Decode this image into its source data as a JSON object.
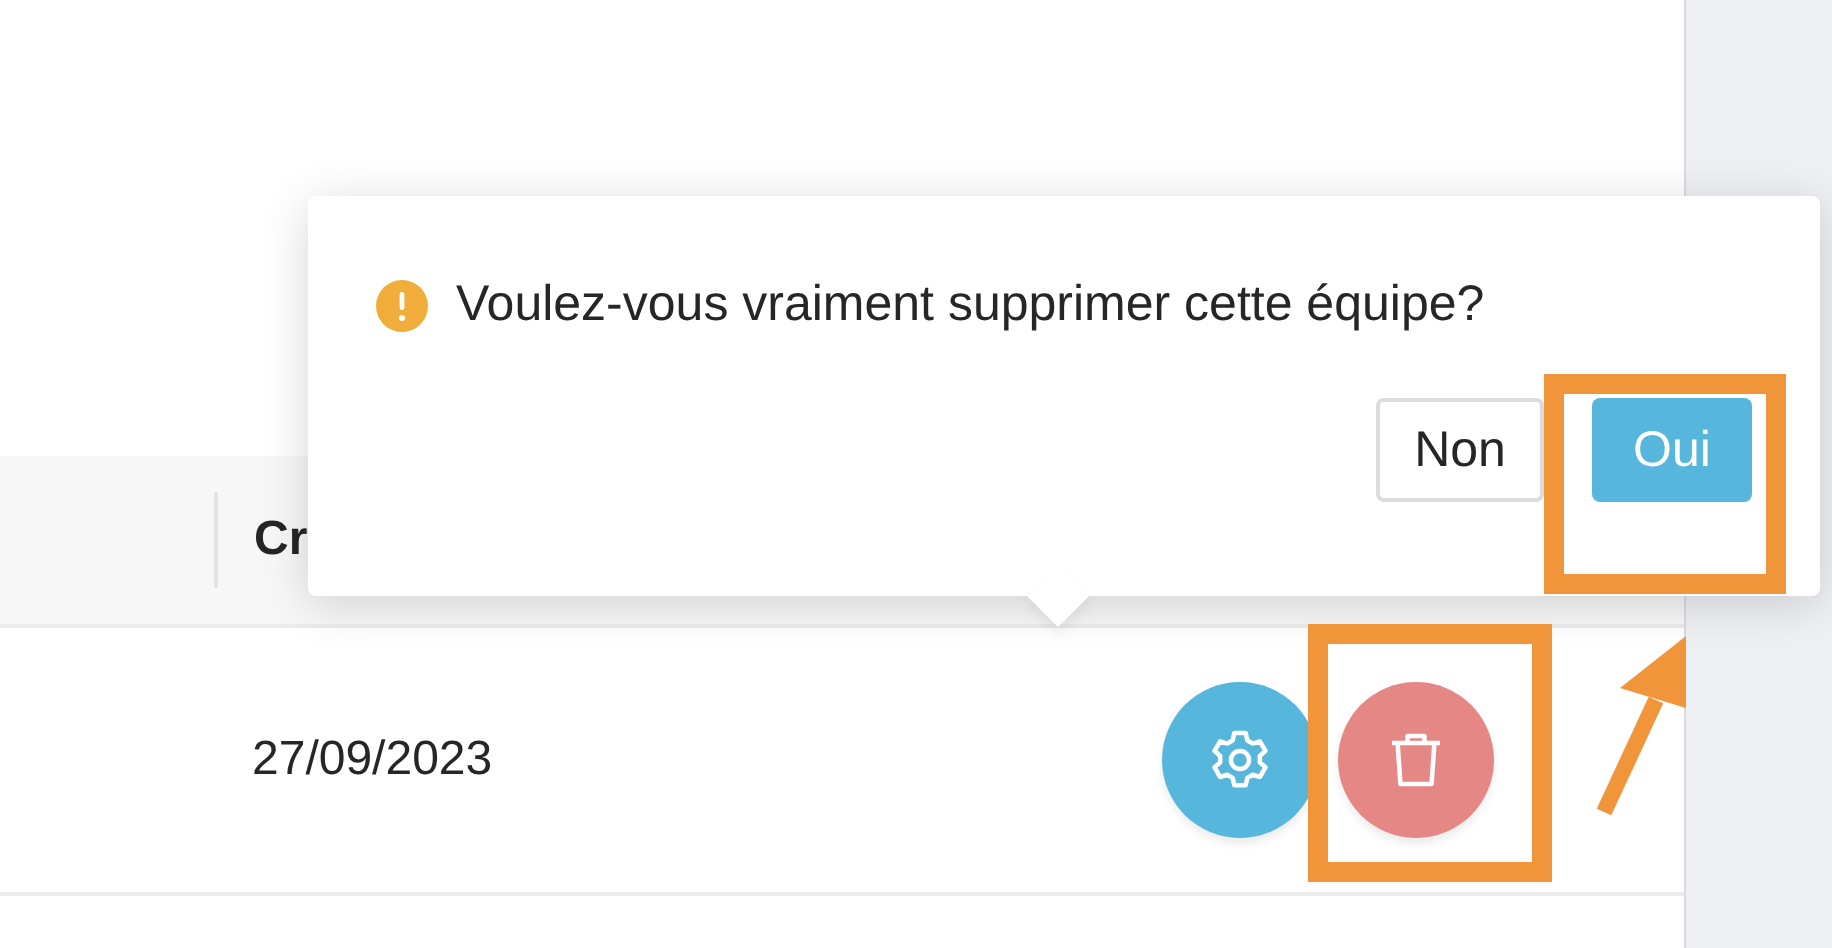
{
  "table": {
    "column_header": "Cr",
    "rows": [
      {
        "date": "27/09/2023",
        "actions": [
          {
            "kind": "settings"
          },
          {
            "kind": "delete"
          }
        ]
      }
    ]
  },
  "popconfirm": {
    "message": "Voulez-vous vraiment supprimer cette équipe?",
    "buttons": [
      {
        "label": "Non",
        "kind": "default"
      },
      {
        "label": "Oui",
        "kind": "primary"
      }
    ]
  }
}
